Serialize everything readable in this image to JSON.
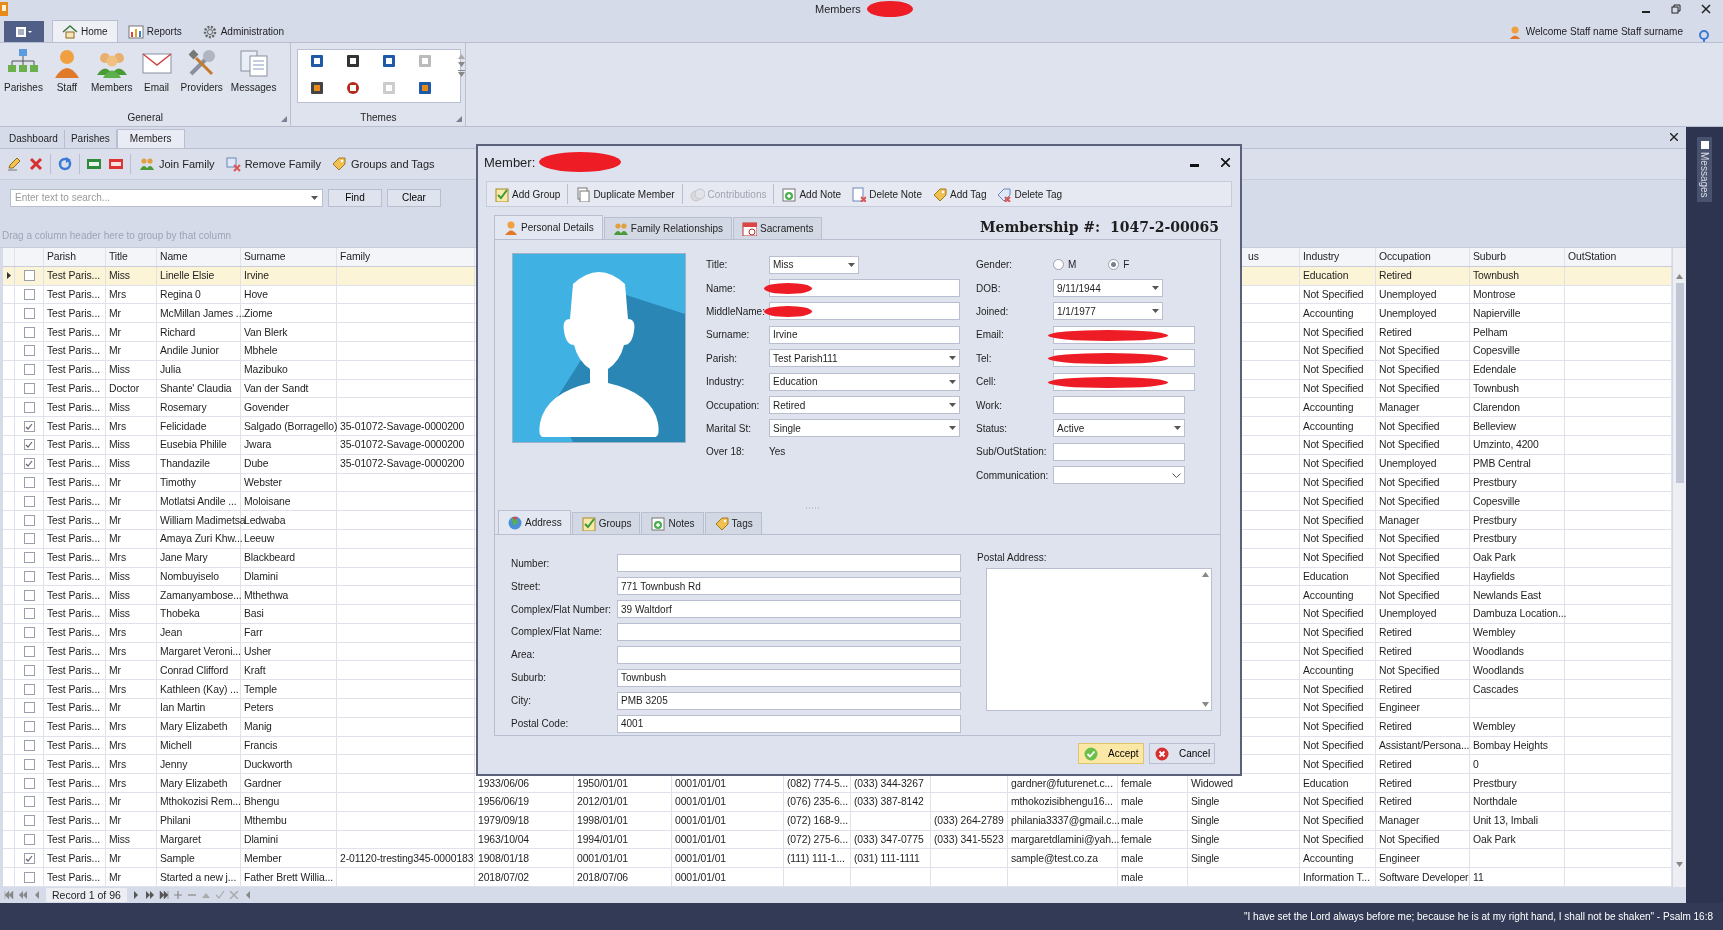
{
  "window": {
    "title": "Members",
    "title_redacted": true
  },
  "ribbon": {
    "tabs": [
      {
        "label": "Home",
        "selected": true
      },
      {
        "label": "Reports",
        "selected": false
      },
      {
        "label": "Administration",
        "selected": false
      }
    ],
    "welcome": "Welcome Staff name Staff surname",
    "groups": [
      {
        "label": "General",
        "kind": "buttons",
        "buttons": [
          "Parishes",
          "Staff",
          "Members",
          "Email",
          "Providers",
          "Messages"
        ]
      },
      {
        "label": "Themes",
        "kind": "gallery"
      }
    ]
  },
  "doc_tabs": [
    {
      "label": "Dashboard",
      "selected": false
    },
    {
      "label": "Parishes",
      "selected": false
    },
    {
      "label": "Members",
      "selected": true
    }
  ],
  "toolbar": [
    "Join Family",
    "Remove Family",
    "Groups and Tags"
  ],
  "search": {
    "placeholder": "Enter text to search...",
    "buttons": [
      "Find",
      "Clear"
    ]
  },
  "group_panel_hint": "Drag a column header here to group by that column",
  "grid": {
    "columns": [
      "Parish",
      "Title",
      "Name",
      "Surname",
      "Family",
      null,
      null,
      null,
      null,
      null,
      null,
      null,
      null,
      "us",
      "Industry",
      "Occupation",
      "Suburb",
      "OutStation"
    ],
    "rows": [
      {
        "selected": true,
        "checked": false,
        "cells": [
          "Test Paris...",
          "Miss",
          "Linelle  Elsie",
          "Irvine",
          null,
          null,
          null,
          null,
          null,
          null,
          null,
          null,
          null,
          null,
          "Education",
          "Retired",
          "Townbush",
          null
        ]
      },
      {
        "selected": false,
        "checked": false,
        "cells": [
          "Test Paris...",
          "Mrs",
          "Regina 0",
          "Hove",
          null,
          null,
          null,
          null,
          null,
          null,
          null,
          null,
          null,
          null,
          "Not Specified",
          "Unemployed",
          "Montrose",
          null
        ]
      },
      {
        "selected": false,
        "checked": false,
        "cells": [
          "Test Paris...",
          "Mr",
          "McMillan James ...",
          "Ziome",
          null,
          null,
          null,
          null,
          null,
          null,
          null,
          null,
          null,
          null,
          "Accounting",
          "Unemployed",
          "Napierville",
          null
        ]
      },
      {
        "selected": false,
        "checked": false,
        "cells": [
          "Test Paris...",
          "Mr",
          "Richard",
          "Van Blerk",
          null,
          null,
          null,
          null,
          null,
          null,
          null,
          null,
          null,
          null,
          "Not Specified",
          "Retired",
          "Pelham",
          null
        ]
      },
      {
        "selected": false,
        "checked": false,
        "cells": [
          "Test Paris...",
          "Mr",
          "Andile Junior",
          "Mbhele",
          null,
          null,
          null,
          null,
          null,
          null,
          null,
          null,
          null,
          null,
          "Not Specified",
          "Not Specified",
          "Copesville",
          null
        ]
      },
      {
        "selected": false,
        "checked": false,
        "cells": [
          "Test Paris...",
          "Miss",
          "Julia",
          "Mazibuko",
          null,
          null,
          null,
          null,
          null,
          null,
          null,
          null,
          null,
          null,
          "Not Specified",
          "Not Specified",
          "Edendale",
          null
        ]
      },
      {
        "selected": false,
        "checked": false,
        "cells": [
          "Test Paris...",
          "Doctor",
          "Shante' Claudia",
          "Van der Sandt",
          null,
          null,
          null,
          null,
          null,
          null,
          null,
          null,
          null,
          null,
          "Not Specified",
          "Not Specified",
          "Townbush",
          null
        ]
      },
      {
        "selected": false,
        "checked": false,
        "cells": [
          "Test Paris...",
          "Miss",
          "Rosemary",
          "Govender",
          null,
          null,
          null,
          null,
          null,
          null,
          null,
          null,
          null,
          null,
          "Accounting",
          "Manager",
          "Clarendon",
          null
        ]
      },
      {
        "selected": false,
        "checked": true,
        "cells": [
          "Test Paris...",
          "Mrs",
          "Felicidade",
          "Salgado (Borragello)",
          "35-01072-Savage-0000200",
          null,
          null,
          null,
          null,
          null,
          null,
          null,
          null,
          null,
          "Accounting",
          "Not Specified",
          "Belleview",
          null
        ]
      },
      {
        "selected": false,
        "checked": true,
        "cells": [
          "Test Paris...",
          "Miss",
          "Eusebia Philile",
          "Jwara",
          "35-01072-Savage-0000200",
          null,
          null,
          null,
          null,
          null,
          null,
          null,
          null,
          null,
          "Not Specified",
          "Not Specified",
          "Umzinto, 4200",
          null
        ]
      },
      {
        "selected": false,
        "checked": true,
        "cells": [
          "Test Paris...",
          "Miss",
          "Thandazile",
          "Dube",
          "35-01072-Savage-0000200",
          null,
          null,
          null,
          null,
          null,
          null,
          null,
          null,
          null,
          "Not Specified",
          "Unemployed",
          "PMB Central",
          null
        ]
      },
      {
        "selected": false,
        "checked": false,
        "cells": [
          "Test Paris...",
          "Mr",
          "Timothy",
          "Webster",
          null,
          null,
          null,
          null,
          null,
          null,
          null,
          null,
          null,
          null,
          "Not Specified",
          "Not Specified",
          "Prestbury",
          null
        ]
      },
      {
        "selected": false,
        "checked": false,
        "cells": [
          "Test Paris...",
          "Mr",
          "Motlatsi Andile ...",
          "Moloisane",
          null,
          null,
          null,
          null,
          null,
          null,
          null,
          null,
          null,
          null,
          "Not Specified",
          "Not Specified",
          "Copesville",
          null
        ]
      },
      {
        "selected": false,
        "checked": false,
        "cells": [
          "Test Paris...",
          "Mr",
          "William Madimetsa",
          "Ledwaba",
          null,
          null,
          null,
          null,
          null,
          null,
          null,
          null,
          null,
          null,
          "Not Specified",
          "Manager",
          "Prestbury",
          null
        ]
      },
      {
        "selected": false,
        "checked": false,
        "cells": [
          "Test Paris...",
          "Mr",
          "Amaya Zuri Khw...",
          "Leeuw",
          null,
          null,
          null,
          null,
          null,
          null,
          null,
          null,
          null,
          null,
          "Not Specified",
          "Not Specified",
          "Prestbury",
          null
        ]
      },
      {
        "selected": false,
        "checked": false,
        "cells": [
          "Test Paris...",
          "Mrs",
          "Jane Mary",
          "Blackbeard",
          null,
          null,
          null,
          null,
          null,
          null,
          null,
          null,
          null,
          null,
          "Not Specified",
          "Not Specified",
          "Oak Park",
          null
        ]
      },
      {
        "selected": false,
        "checked": false,
        "cells": [
          "Test Paris...",
          "Miss",
          "Nombuyiselo",
          "Dlamini",
          null,
          null,
          null,
          null,
          null,
          null,
          null,
          null,
          null,
          null,
          "Education",
          "Not Specified",
          "Hayfields",
          null
        ]
      },
      {
        "selected": false,
        "checked": false,
        "cells": [
          "Test Paris...",
          "Miss",
          "Zamanyambose...",
          "Mthethwa",
          null,
          null,
          null,
          null,
          null,
          null,
          null,
          null,
          null,
          null,
          "Accounting",
          "Not Specified",
          "Newlands East",
          null
        ]
      },
      {
        "selected": false,
        "checked": false,
        "cells": [
          "Test Paris...",
          "Miss",
          "Thobeka",
          "Basi",
          null,
          null,
          null,
          null,
          null,
          null,
          null,
          null,
          null,
          null,
          "Not Specified",
          "Unemployed",
          "Dambuza Location...",
          null
        ]
      },
      {
        "selected": false,
        "checked": false,
        "cells": [
          "Test Paris...",
          "Mrs",
          "Jean",
          "Farr",
          null,
          null,
          null,
          null,
          null,
          null,
          null,
          null,
          null,
          null,
          "Not Specified",
          "Retired",
          "Wembley",
          null
        ]
      },
      {
        "selected": false,
        "checked": false,
        "cells": [
          "Test Paris...",
          "Mrs",
          "Margaret Veroni...",
          "Usher",
          null,
          null,
          null,
          null,
          null,
          null,
          null,
          null,
          null,
          null,
          "Not Specified",
          "Retired",
          "Woodlands",
          null
        ]
      },
      {
        "selected": false,
        "checked": false,
        "cells": [
          "Test Paris...",
          "Mr",
          "Conrad Clifford",
          "Kraft",
          null,
          null,
          null,
          null,
          null,
          null,
          null,
          null,
          null,
          null,
          "Accounting",
          "Not Specified",
          "Woodlands",
          null
        ]
      },
      {
        "selected": false,
        "checked": false,
        "cells": [
          "Test Paris...",
          "Mrs",
          "Kathleen (Kay) ...",
          "Temple",
          null,
          null,
          null,
          null,
          null,
          null,
          null,
          null,
          null,
          null,
          "Not Specified",
          "Retired",
          "Cascades",
          null
        ]
      },
      {
        "selected": false,
        "checked": false,
        "cells": [
          "Test Paris...",
          "Mr",
          "Ian Martin",
          "Peters",
          null,
          null,
          null,
          null,
          null,
          null,
          null,
          null,
          null,
          null,
          "Not Specified",
          "Engineer",
          null,
          null
        ]
      },
      {
        "selected": false,
        "checked": false,
        "cells": [
          "Test Paris...",
          "Mrs",
          "Mary Elizabeth",
          "Manig",
          null,
          null,
          null,
          null,
          null,
          null,
          null,
          null,
          null,
          null,
          "Not Specified",
          "Retired",
          "Wembley",
          null
        ]
      },
      {
        "selected": false,
        "checked": false,
        "cells": [
          "Test Paris...",
          "Mrs",
          "Michell",
          "Francis",
          null,
          null,
          null,
          null,
          null,
          null,
          null,
          null,
          null,
          null,
          "Not Specified",
          "Assistant/Persona...",
          "Bombay Heights",
          null
        ]
      },
      {
        "selected": false,
        "checked": false,
        "cells": [
          "Test Paris...",
          "Mrs",
          "Jenny",
          "Duckworth",
          null,
          null,
          null,
          null,
          null,
          null,
          null,
          null,
          null,
          null,
          "Not Specified",
          "Retired",
          "0",
          null
        ]
      },
      {
        "selected": false,
        "checked": false,
        "cells": [
          "Test Paris...",
          "Mrs",
          "Mary Elizabeth",
          "Gardner",
          null,
          "1933/06/06",
          "1950/01/01",
          "0001/01/01",
          "(082) 774-5...",
          "(033) 344-3267",
          null,
          "gardner@futurenet.c...",
          "female",
          "Widowed",
          "Education",
          "Retired",
          "Prestbury",
          null
        ]
      },
      {
        "selected": false,
        "checked": false,
        "cells": [
          "Test Paris...",
          "Mr",
          "Mthokozisi Rem...",
          "Bhengu",
          null,
          "1956/06/19",
          "2012/01/01",
          "0001/01/01",
          "(076) 235-6...",
          "(033) 387-8142",
          null,
          "mthokozisibhengu16...",
          "male",
          "Single",
          "Not Specified",
          "Retired",
          "Northdale",
          null
        ]
      },
      {
        "selected": false,
        "checked": false,
        "cells": [
          "Test Paris...",
          "Mr",
          "Philani",
          "Mthembu",
          null,
          "1979/09/18",
          "1998/01/01",
          "0001/01/01",
          "(072) 168-9...",
          null,
          "(033) 264-2789",
          "philania3337@gmail.c...",
          "male",
          "Single",
          "Not Specified",
          "Manager",
          "Unit 13, Imbali",
          null
        ]
      },
      {
        "selected": false,
        "checked": false,
        "cells": [
          "Test Paris...",
          "Miss",
          "Margaret",
          "Dlamini",
          null,
          "1963/10/04",
          "1994/01/01",
          "0001/01/01",
          "(072) 275-6...",
          "(033) 347-0775",
          "(033) 341-5523",
          "margaretdlamini@yah...",
          "female",
          "Single",
          "Not Specified",
          "Not Specified",
          "Oak Park",
          null
        ]
      },
      {
        "selected": false,
        "checked": true,
        "cells": [
          "Test Paris...",
          "Mr",
          "Sample",
          "Member",
          "2-01120-tresting345-0000183",
          "1908/01/18",
          "0001/01/01",
          "0001/01/01",
          "(111) 111-1...",
          "(031) 111-1111",
          null,
          "sample@test.co.za",
          "male",
          "Single",
          "Accounting",
          "Engineer",
          null,
          null
        ]
      },
      {
        "selected": false,
        "checked": false,
        "cells": [
          "Test Paris...",
          "Mr",
          "Started a new j...",
          "Father Brett Willia...",
          null,
          "2018/07/02",
          "2018/07/06",
          "0001/01/01",
          null,
          null,
          null,
          null,
          "male",
          null,
          "Information T...",
          "Software Developer",
          "11",
          null
        ]
      }
    ]
  },
  "navigator": {
    "record": "Record 1 of 96"
  },
  "side_panel": {
    "label": "Messages"
  },
  "status_bar": {
    "quote": "\"I have set the Lord always before me; because he is at my right hand, I shall not be shaken\" - Psalm 16:8"
  },
  "dialog": {
    "title": "Member:",
    "title_redacted": true,
    "toolbar": [
      {
        "label": "Add Group",
        "disabled": false
      },
      {
        "label": "Duplicate Member",
        "disabled": false
      },
      {
        "label": "Contributions",
        "disabled": true
      },
      {
        "label": "Add Note",
        "disabled": false
      },
      {
        "label": "Delete Note",
        "disabled": false
      },
      {
        "label": "Add Tag",
        "disabled": false
      },
      {
        "label": "Delete Tag",
        "disabled": false
      }
    ],
    "tabs": [
      {
        "label": "Personal Details",
        "selected": true
      },
      {
        "label": "Family Relationships",
        "selected": false
      },
      {
        "label": "Sacraments",
        "selected": false
      }
    ],
    "membership": {
      "label": "Membership #:",
      "value": "1047-2-00065"
    },
    "fields_left": [
      {
        "label": "Title:",
        "kind": "dropdown",
        "value": "Miss"
      },
      {
        "label": "Name:",
        "kind": "text",
        "redacted": true
      },
      {
        "label": "MiddleName:",
        "kind": "text",
        "redacted": true
      },
      {
        "label": "Surname:",
        "kind": "text",
        "value": "Irvine"
      },
      {
        "label": "Parish:",
        "kind": "dropdown",
        "value": "Test Parish111"
      },
      {
        "label": "Industry:",
        "kind": "dropdown",
        "value": "Education"
      },
      {
        "label": "Occupation:",
        "kind": "dropdown",
        "value": "Retired"
      },
      {
        "label": "Marital St:",
        "kind": "dropdown",
        "value": "Single"
      },
      {
        "label": "Over 18:",
        "kind": "readonly",
        "value": "Yes"
      }
    ],
    "fields_right": [
      {
        "label": "Gender:",
        "kind": "radio",
        "options": [
          {
            "label": "M",
            "selected": false
          },
          {
            "label": "F",
            "selected": true
          }
        ]
      },
      {
        "label": "DOB:",
        "kind": "date",
        "value": "9/11/1944"
      },
      {
        "label": "Joined:",
        "kind": "date",
        "value": "1/1/1977"
      },
      {
        "label": "Email:",
        "kind": "text",
        "redacted": true
      },
      {
        "label": "Tel:",
        "kind": "text",
        "redacted": true
      },
      {
        "label": "Cell:",
        "kind": "text",
        "redacted": true
      },
      {
        "label": "Work:",
        "kind": "text"
      },
      {
        "label": "Status:",
        "kind": "dropdown",
        "value": "Active"
      },
      {
        "label": "Sub/OutStation:",
        "kind": "text"
      },
      {
        "label": "Communication:",
        "kind": "combo"
      }
    ],
    "sub_tabs": [
      {
        "label": "Address",
        "selected": true
      },
      {
        "label": "Groups",
        "selected": false
      },
      {
        "label": "Notes",
        "selected": false
      },
      {
        "label": "Tags",
        "selected": false
      }
    ],
    "address_fields": [
      {
        "label": "Number:"
      },
      {
        "label": "Street:",
        "value": "771 Townbush Rd"
      },
      {
        "label": "Complex/Flat Number:",
        "value": "39 Waltdorf"
      },
      {
        "label": "Complex/Flat Name:"
      },
      {
        "label": "Area:"
      },
      {
        "label": "Suburb:",
        "value": "Townbush"
      },
      {
        "label": "City:",
        "value": "PMB 3205"
      },
      {
        "label": "Postal Code:",
        "value": "4001"
      }
    ],
    "postal_address": {
      "label": "Postal Address:"
    },
    "buttons": [
      {
        "label": "Accept",
        "kind": "accept"
      },
      {
        "label": "Cancel",
        "kind": "cancel"
      }
    ]
  }
}
